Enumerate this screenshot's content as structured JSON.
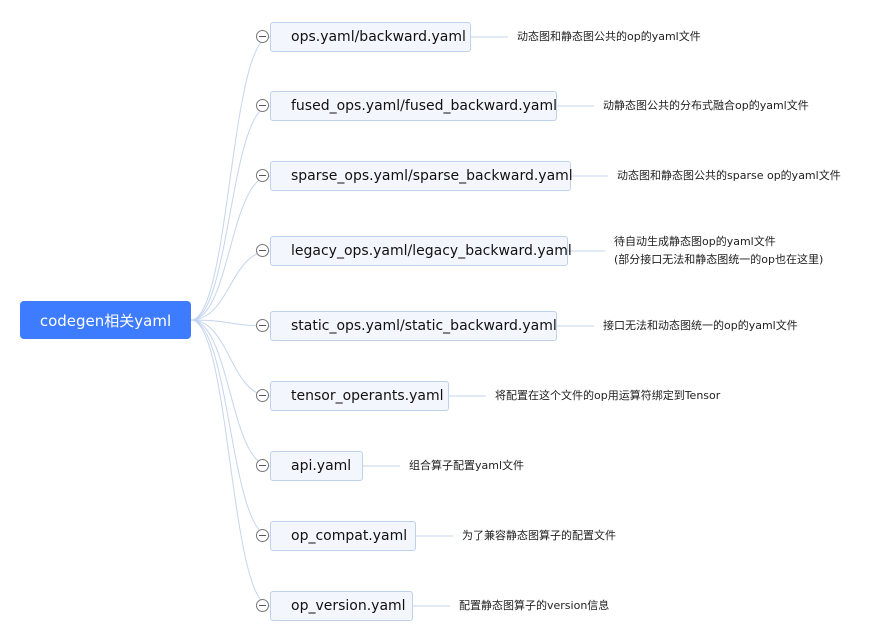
{
  "root": {
    "label": "codegen相关yaml"
  },
  "colors": {
    "root_fill": "#3d7bff",
    "node_fill": "#f3f7fd",
    "node_border": "#bfd2ec",
    "connector": "#c5d5ee"
  },
  "children": [
    {
      "label": "ops.yaml/backward.yaml",
      "note": "动态图和静态图公共的op的yaml文件"
    },
    {
      "label": "fused_ops.yaml/fused_backward.yaml",
      "note": "动静态图公共的分布式融合op的yaml文件"
    },
    {
      "label": "sparse_ops.yaml/sparse_backward.yaml",
      "note": "动态图和静态图公共的sparse op的yaml文件"
    },
    {
      "label": "legacy_ops.yaml/legacy_backward.yaml",
      "note": "待自动生成静态图op的yaml文件",
      "note2": "(部分接口无法和静态图统一的op也在这里)"
    },
    {
      "label": "static_ops.yaml/static_backward.yaml",
      "note": "接口无法和动态图统一的op的yaml文件"
    },
    {
      "label": "tensor_operants.yaml",
      "note": "将配置在这个文件的op用运算符绑定到Tensor"
    },
    {
      "label": "api.yaml",
      "note": "组合算子配置yaml文件"
    },
    {
      "label": "op_compat.yaml",
      "note": "为了兼容静态图算子的配置文件"
    },
    {
      "label": "op_version.yaml",
      "note": "配置静态图算子的version信息"
    }
  ]
}
